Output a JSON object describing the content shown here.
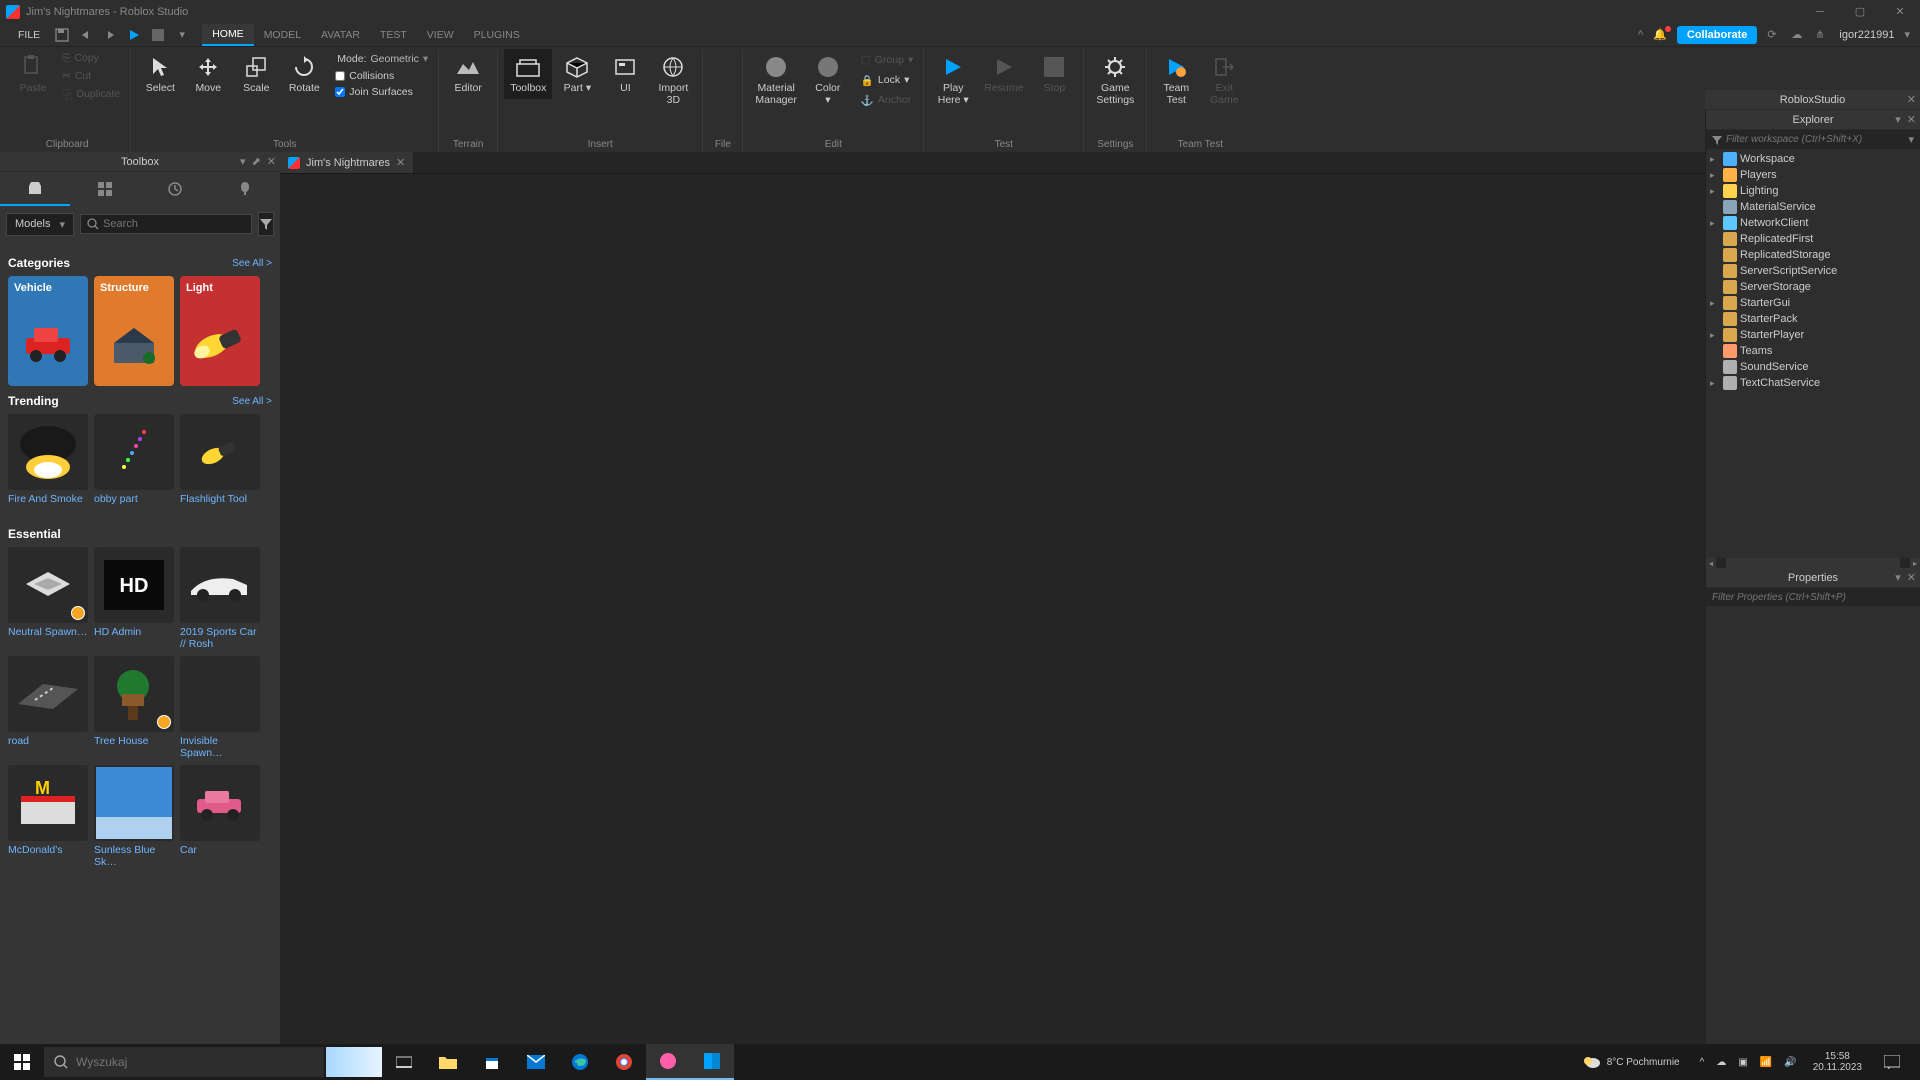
{
  "window": {
    "title": "Jim's Nightmares - Roblox Studio"
  },
  "menubar": {
    "file": "FILE",
    "tabs": [
      "HOME",
      "MODEL",
      "AVATAR",
      "TEST",
      "VIEW",
      "PLUGINS"
    ],
    "active": "HOME",
    "collaborate": "Collaborate",
    "user": "igor221991"
  },
  "ribbon": {
    "clipboard": {
      "paste": "Paste",
      "copy": "Copy",
      "cut": "Cut",
      "duplicate": "Duplicate",
      "label": "Clipboard"
    },
    "tools": {
      "select": "Select",
      "move": "Move",
      "scale": "Scale",
      "rotate": "Rotate",
      "mode_lbl": "Mode:",
      "mode_val": "Geometric",
      "collisions": "Collisions",
      "join": "Join Surfaces",
      "label": "Tools"
    },
    "terrain": {
      "editor": "Editor",
      "label": "Terrain"
    },
    "insert": {
      "toolbox": "Toolbox",
      "part": "Part",
      "ui": "UI",
      "import": "Import\n3D",
      "label": "Insert"
    },
    "file": {
      "label": "File"
    },
    "material": {
      "mm": "Material\nManager",
      "color": "Color",
      "group": "Group",
      "lock": "Lock",
      "anchor": "Anchor",
      "label": "Edit"
    },
    "test": {
      "play": "Play\nHere",
      "resume": "Resume",
      "stop": "Stop",
      "label": "Test"
    },
    "settings": {
      "gs": "Game\nSettings",
      "label": "Settings"
    },
    "team": {
      "tt": "Team\nTest",
      "exit": "Exit\nGame",
      "label": "Team Test"
    }
  },
  "doctab": {
    "name": "Jim's Nightmares"
  },
  "toolbox": {
    "title": "Toolbox",
    "dropdown": "Models",
    "search_ph": "Search",
    "categories": {
      "title": "Categories",
      "seeall": "See All >",
      "items": [
        {
          "name": "Vehicle",
          "bg": "#2f77b5"
        },
        {
          "name": "Structure",
          "bg": "#e07a2c"
        },
        {
          "name": "Light",
          "bg": "#c53030"
        }
      ]
    },
    "trending": {
      "title": "Trending",
      "seeall": "See All >",
      "items": [
        {
          "name": "Fire And Smoke"
        },
        {
          "name": "obby part"
        },
        {
          "name": "Flashlight Tool"
        }
      ]
    },
    "essential": {
      "title": "Essential",
      "items": [
        {
          "name": "Neutral Spawn…",
          "badge": true
        },
        {
          "name": "HD Admin"
        },
        {
          "name": "2019 Sports Car // Rosh"
        },
        {
          "name": "road"
        },
        {
          "name": "Tree House",
          "badge": true
        },
        {
          "name": "Invisible Spawn…"
        },
        {
          "name": "McDonald's"
        },
        {
          "name": "Sunless Blue Sk…"
        },
        {
          "name": "Car"
        }
      ]
    }
  },
  "studio_pane": "RobloxStudio",
  "explorer": {
    "title": "Explorer",
    "filter_ph": "Filter workspace (Ctrl+Shift+X)",
    "items": [
      {
        "name": "Workspace",
        "exp": true,
        "ico": "#4db1ff"
      },
      {
        "name": "Players",
        "exp": true,
        "ico": "#ffb347"
      },
      {
        "name": "Lighting",
        "exp": true,
        "ico": "#ffd24d"
      },
      {
        "name": "MaterialService",
        "exp": false,
        "ico": "#8aa4b8"
      },
      {
        "name": "NetworkClient",
        "exp": true,
        "ico": "#5cc8ff"
      },
      {
        "name": "ReplicatedFirst",
        "exp": false,
        "ico": "#d9a84e"
      },
      {
        "name": "ReplicatedStorage",
        "exp": false,
        "ico": "#d9a84e"
      },
      {
        "name": "ServerScriptService",
        "exp": false,
        "ico": "#d9a84e"
      },
      {
        "name": "ServerStorage",
        "exp": false,
        "ico": "#d9a84e"
      },
      {
        "name": "StarterGui",
        "exp": true,
        "ico": "#d9a84e"
      },
      {
        "name": "StarterPack",
        "exp": false,
        "ico": "#d9a84e"
      },
      {
        "name": "StarterPlayer",
        "exp": true,
        "ico": "#d9a84e"
      },
      {
        "name": "Teams",
        "exp": false,
        "ico": "#ff9a6b"
      },
      {
        "name": "SoundService",
        "exp": false,
        "ico": "#b0b0b0"
      },
      {
        "name": "TextChatService",
        "exp": true,
        "ico": "#b0b0b0"
      }
    ]
  },
  "properties": {
    "title": "Properties",
    "filter_ph": "Filter Properties (Ctrl+Shift+P)"
  },
  "taskbar": {
    "search_ph": "Wyszukaj",
    "weather": "8°C  Pochmurnie",
    "time": "15:58",
    "date": "20.11.2023"
  }
}
